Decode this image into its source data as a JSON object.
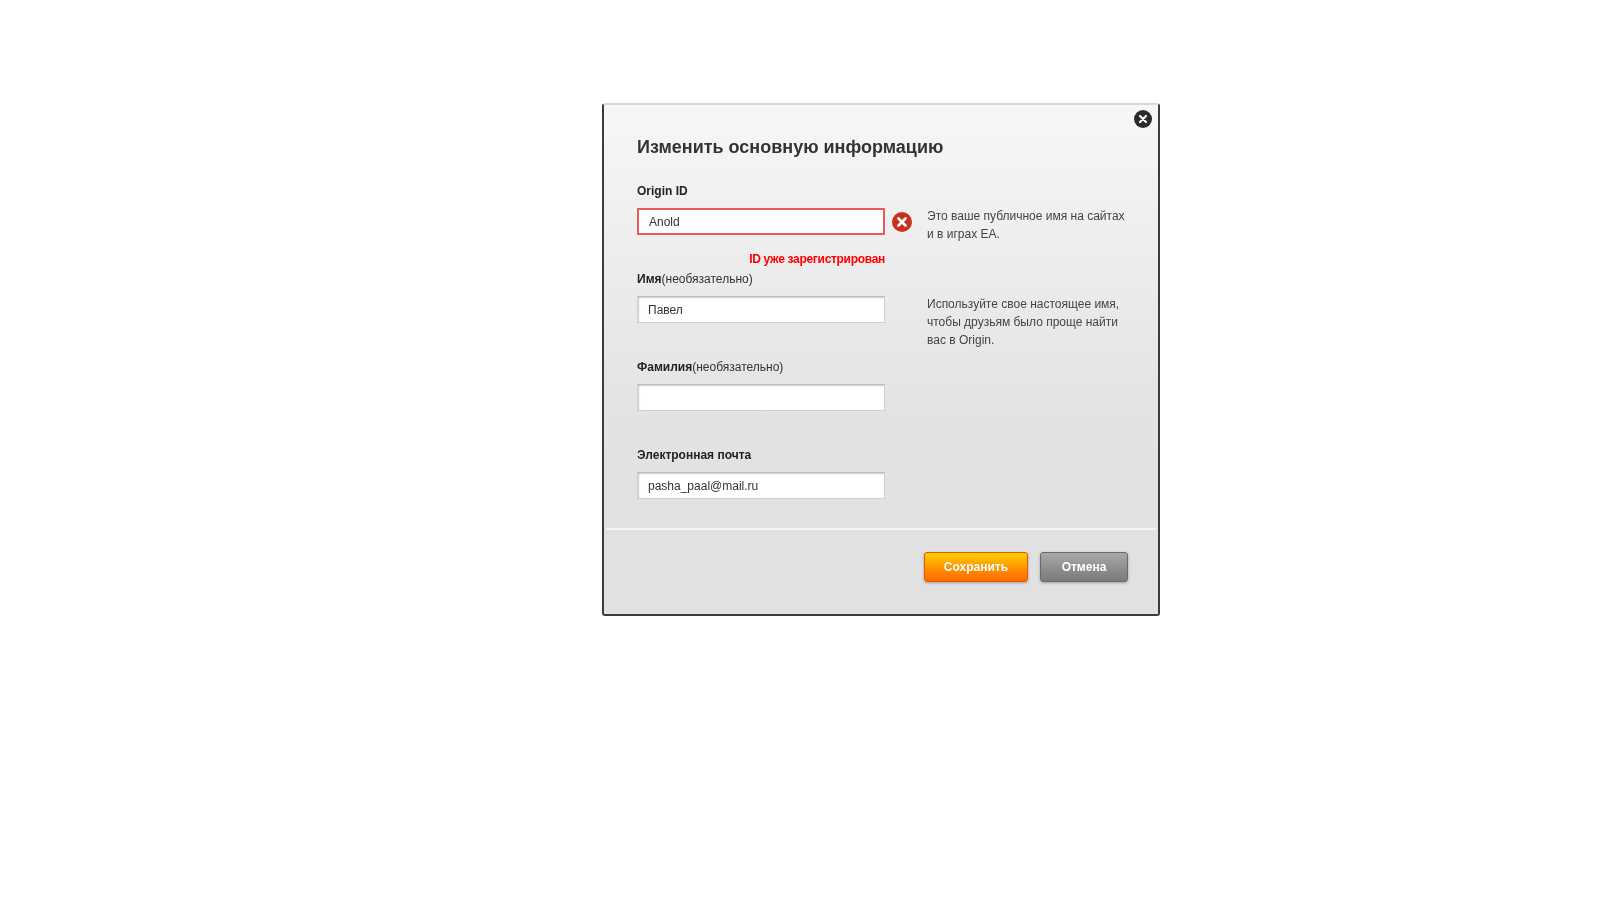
{
  "dialog": {
    "title": "Изменить основную информацию",
    "fields": [
      {
        "label": "Origin ID",
        "value": "Anold",
        "invalid": true,
        "error": "ID уже зарегистрирован",
        "hint": "Это ваше публичное имя на сайтах и в играх EA."
      },
      {
        "label": "Имя",
        "optional": "(необязательно)",
        "value": "Павел",
        "invalid": false,
        "hint": "Используйте свое настоящее имя, чтобы друзьям было проще найти вас в Origin."
      },
      {
        "label": "Фамилия",
        "optional": "(необязательно)",
        "invalid": false
      },
      {
        "label": "Электронная почта",
        "value": "pasha_paal@mail.ru",
        "invalid": false
      }
    ],
    "buttons": [
      {
        "label": "Сохранить",
        "kind": "primary"
      },
      {
        "label": "Отмена",
        "kind": "secondary"
      }
    ]
  }
}
